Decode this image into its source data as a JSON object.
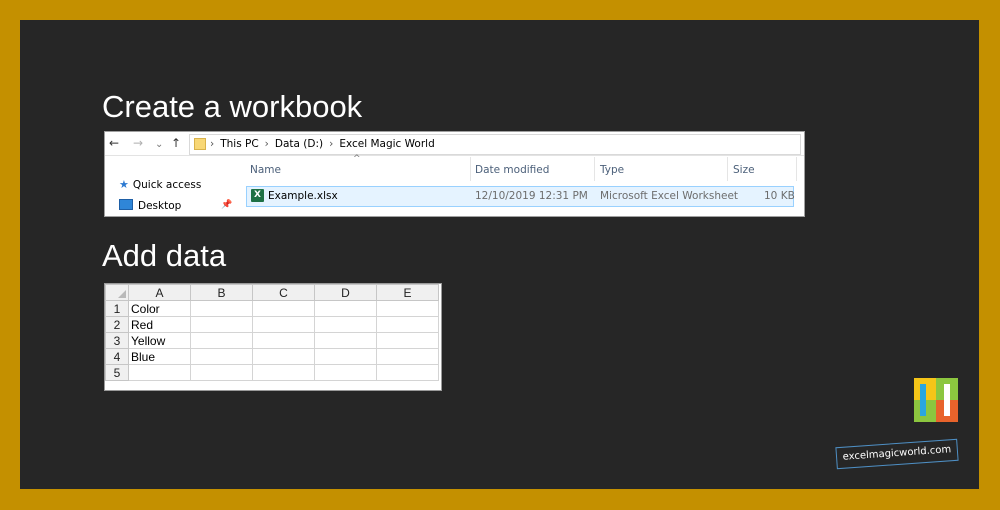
{
  "slide": {
    "heading1": "Create a workbook",
    "heading2": "Add data"
  },
  "explorer": {
    "nav": {
      "back": "←",
      "forward": "→",
      "recent": "⌄",
      "up": "↑"
    },
    "breadcrumb": [
      "This PC",
      "Data (D:)",
      "Excel Magic World"
    ],
    "breadcrumb_separator": "›",
    "sidebar": [
      {
        "label": "Quick access",
        "icon": "star-icon"
      },
      {
        "label": "Desktop",
        "icon": "desktop-icon",
        "pinned": true
      }
    ],
    "columns": [
      "Name",
      "Date modified",
      "Type",
      "Size"
    ],
    "sort_indicator": "^",
    "files": [
      {
        "name": "Example.xlsx",
        "date_modified": "12/10/2019 12:31 PM",
        "type": "Microsoft Excel Worksheet",
        "size": "10 KB",
        "icon": "excel-file-icon",
        "selected": true
      }
    ]
  },
  "sheet": {
    "columns": [
      "A",
      "B",
      "C",
      "D",
      "E"
    ],
    "rows": [
      {
        "num": "1",
        "cells": [
          "Color",
          "",
          "",
          "",
          ""
        ]
      },
      {
        "num": "2",
        "cells": [
          "Red",
          "",
          "",
          "",
          ""
        ]
      },
      {
        "num": "3",
        "cells": [
          "Yellow",
          "",
          "",
          "",
          ""
        ]
      },
      {
        "num": "4",
        "cells": [
          "Blue",
          "",
          "",
          "",
          ""
        ]
      },
      {
        "num": "5",
        "cells": [
          "",
          "",
          "",
          "",
          ""
        ]
      }
    ]
  },
  "branding": {
    "url": "excelmagicworld.com",
    "logo_colors": [
      "#f5c518",
      "#8cc63f",
      "#e8632b",
      "#2aa6df"
    ]
  },
  "colors": {
    "frame": "#c49000",
    "background": "#262626",
    "heading": "#ffffff",
    "selection": "#e5f3ff"
  }
}
